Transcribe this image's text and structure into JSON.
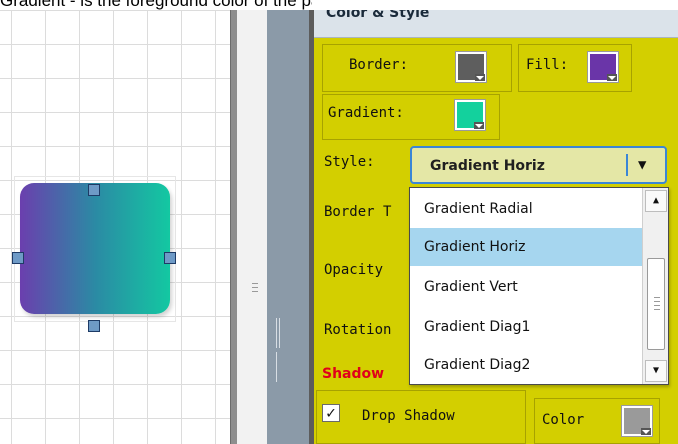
{
  "caption": "Gradient - is the foreground color of the pattern.",
  "panel": {
    "title": "Color & Style",
    "border_label": "Border:",
    "fill_label": "Fill:",
    "gradient_label": "Gradient:",
    "style_label": "Style:",
    "border_thickness_label": "Border T",
    "opacity_label": "Opacity",
    "rotation_label": "Rotation",
    "shadow_label": "Shadow",
    "drop_shadow_label": "Drop Shadow",
    "shadow_color_label": "Color"
  },
  "colors": {
    "border": "#5e5e5e",
    "fill": "#6a35a8",
    "gradient": "#13d19d",
    "shadow_color": "#9a9a9a",
    "panel_bg": "#d3cf00",
    "selection": "#a6d6ef"
  },
  "style_select": {
    "value": "Gradient Horiz",
    "arrow": "▼"
  },
  "dropdown": {
    "options": [
      "Gradient Radial",
      "Gradient Horiz",
      "Gradient Vert",
      "Gradient Diag1",
      "Gradient Diag2"
    ],
    "selected": "Gradient Horiz",
    "scroll_up": "▲",
    "scroll_down": "▼"
  },
  "drop_shadow_checked": true,
  "checkmark": "✓"
}
